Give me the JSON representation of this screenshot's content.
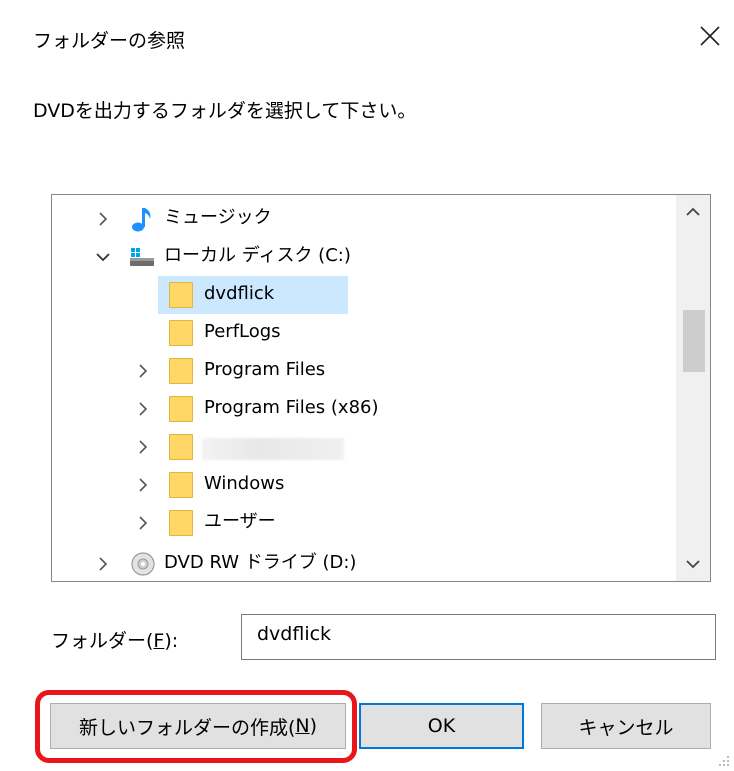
{
  "dialog": {
    "title": "フォルダーの参照",
    "close_glyph": "✕",
    "prompt": "DVDを出力するフォルダを選択して下さい。"
  },
  "tree": {
    "items": [
      {
        "label": "ミュージック",
        "icon": "music-note-icon",
        "expandable": true,
        "expanded": false
      },
      {
        "label": "ローカル ディスク (C:)",
        "icon": "local-disk-icon",
        "expandable": true,
        "expanded": true
      },
      {
        "label": "dvdflick",
        "icon": "folder-icon",
        "expandable": false,
        "selected": true
      },
      {
        "label": "PerfLogs",
        "icon": "folder-icon",
        "expandable": false
      },
      {
        "label": "Program Files",
        "icon": "folder-icon",
        "expandable": true
      },
      {
        "label": "Program Files (x86)",
        "icon": "folder-icon",
        "expandable": true
      },
      {
        "label": "",
        "icon": "folder-icon",
        "expandable": true,
        "redacted": true
      },
      {
        "label": "Windows",
        "icon": "folder-icon",
        "expandable": true
      },
      {
        "label": "ユーザー",
        "icon": "folder-icon",
        "expandable": true
      },
      {
        "label": "DVD RW ドライブ (D:)",
        "icon": "dvd-drive-icon",
        "expandable": true
      }
    ]
  },
  "folder_field": {
    "label": "フォルダー(",
    "accel": "F",
    "label_end": "):",
    "value": "dvdflick"
  },
  "buttons": {
    "new_folder_label": "新しいフォルダーの作成(",
    "new_folder_accel": "N",
    "new_folder_end": ")",
    "ok_label": "OK",
    "cancel_label": "キャンセル"
  },
  "colors": {
    "selection": "#cce8ff",
    "highlight_outline": "#e8161b",
    "default_button_border": "#0078d7",
    "folder_fill": "#ffd766"
  }
}
